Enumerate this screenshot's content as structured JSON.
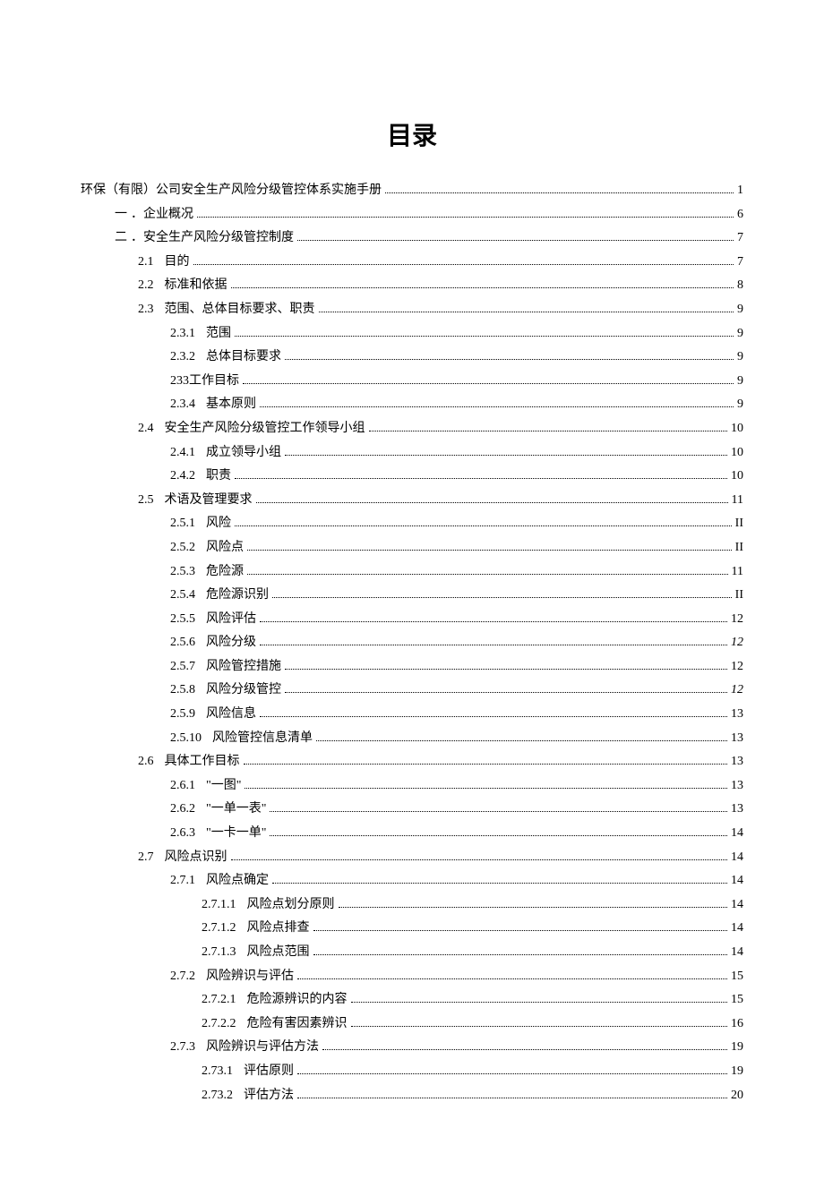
{
  "title": "目录",
  "entries": [
    {
      "indent": 0,
      "label": "",
      "text": "环保（有限）公司安全生产风险分级管控体系实施手册",
      "page": "1",
      "italic": false
    },
    {
      "indent": 1,
      "label": "一",
      "text": "．企业概况",
      "page": "6",
      "italic": false
    },
    {
      "indent": 1,
      "label": "二",
      "text": "．安全生产风险分级管控制度",
      "page": "7",
      "italic": false
    },
    {
      "indent": 2,
      "label": "2.1",
      "text": "目的",
      "page": "7",
      "italic": false
    },
    {
      "indent": 2,
      "label": "2.2",
      "text": "标准和依据",
      "page": "8",
      "italic": false
    },
    {
      "indent": 2,
      "label": "2.3",
      "text": "范围、总体目标要求、职责",
      "page": "9",
      "italic": false
    },
    {
      "indent": 3,
      "label": "2.3.1",
      "text": "范围",
      "page": "9",
      "italic": false
    },
    {
      "indent": 3,
      "label": "2.3.2",
      "text": "总体目标要求",
      "page": "9",
      "italic": false
    },
    {
      "indent": 3,
      "label": "233",
      "text": "工作目标",
      "page": "9",
      "italic": false,
      "nosep": true
    },
    {
      "indent": 3,
      "label": "2.3.4",
      "text": "基本原则",
      "page": "9",
      "italic": false
    },
    {
      "indent": 2,
      "label": "2.4",
      "text": "安全生产风险分级管控工作领导小组",
      "page": "10",
      "italic": false
    },
    {
      "indent": 3,
      "label": "2.4.1",
      "text": "成立领导小组",
      "page": "10",
      "italic": false
    },
    {
      "indent": 3,
      "label": "2.4.2",
      "text": "职责",
      "page": "10",
      "italic": false
    },
    {
      "indent": 2,
      "label": "2.5",
      "text": "术语及管理要求",
      "page": "11",
      "italic": false
    },
    {
      "indent": 3,
      "label": "2.5.1",
      "text": "风险",
      "page": "II",
      "italic": false
    },
    {
      "indent": 3,
      "label": "2.5.2",
      "text": "风险点",
      "page": "II",
      "italic": false
    },
    {
      "indent": 3,
      "label": "2.5.3",
      "text": "危险源",
      "page": "11",
      "italic": false
    },
    {
      "indent": 3,
      "label": "2.5.4",
      "text": "危险源识别",
      "page": "II",
      "italic": false
    },
    {
      "indent": 3,
      "label": "2.5.5",
      "text": "风险评估",
      "page": "12",
      "italic": false
    },
    {
      "indent": 3,
      "label": "2.5.6",
      "text": "风险分级",
      "page": "12",
      "italic": true
    },
    {
      "indent": 3,
      "label": "2.5.7",
      "text": "风险管控措施",
      "page": "12",
      "italic": false
    },
    {
      "indent": 3,
      "label": "2.5.8",
      "text": "风险分级管控",
      "page": "12",
      "italic": true
    },
    {
      "indent": 3,
      "label": "2.5.9",
      "text": "风险信息",
      "page": "13",
      "italic": false
    },
    {
      "indent": 3,
      "label": "2.5.10",
      "text": "风险管控信息清单",
      "page": "13",
      "italic": false
    },
    {
      "indent": 2,
      "label": "2.6",
      "text": "具体工作目标",
      "page": "13",
      "italic": false
    },
    {
      "indent": 3,
      "label": "2.6.1",
      "text": "\"一图\"",
      "page": "13",
      "italic": false
    },
    {
      "indent": 3,
      "label": "2.6.2",
      "text": "\"一单一表\"",
      "page": "13",
      "italic": false
    },
    {
      "indent": 3,
      "label": "2.6.3",
      "text": "\"一卡一单\"",
      "page": "14",
      "italic": false
    },
    {
      "indent": 2,
      "label": "2.7",
      "text": "风险点识别",
      "page": "14",
      "italic": false
    },
    {
      "indent": 3,
      "label": "2.7.1",
      "text": "风险点确定",
      "page": "14",
      "italic": false
    },
    {
      "indent": 4,
      "label": "2.7.1.1",
      "text": "风险点划分原则",
      "page": "14",
      "italic": false
    },
    {
      "indent": 4,
      "label": "2.7.1.2",
      "text": "风险点排查",
      "page": "14",
      "italic": false
    },
    {
      "indent": 4,
      "label": "2.7.1.3",
      "text": "风险点范围",
      "page": "14",
      "italic": false
    },
    {
      "indent": 3,
      "label": "2.7.2",
      "text": "风险辨识与评估",
      "page": "15",
      "italic": false
    },
    {
      "indent": 4,
      "label": "2.7.2.1",
      "text": "危险源辨识的内容",
      "page": "15",
      "italic": false
    },
    {
      "indent": 4,
      "label": "2.7.2.2",
      "text": "危险有害因素辨识",
      "page": "16",
      "italic": false
    },
    {
      "indent": 3,
      "label": "2.7.3",
      "text": "风险辨识与评估方法",
      "page": "19",
      "italic": false
    },
    {
      "indent": 4,
      "label": "2.73.1",
      "text": "评估原则",
      "page": "19",
      "italic": false
    },
    {
      "indent": 4,
      "label": "2.73.2",
      "text": "评估方法",
      "page": "20",
      "italic": false
    }
  ]
}
